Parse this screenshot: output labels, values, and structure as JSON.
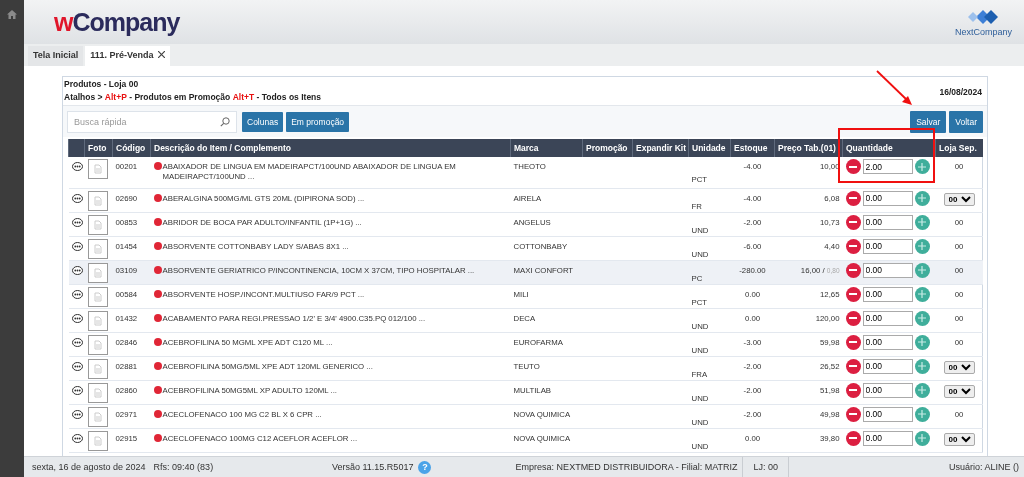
{
  "header": {
    "logo_w": "w",
    "logo_rest": "Company",
    "brand": "NextCompany"
  },
  "tabs": [
    {
      "label": "Tela Inicial",
      "selected": false,
      "closable": false
    },
    {
      "label": "111. Pré-Venda",
      "selected": true,
      "closable": true
    }
  ],
  "panel": {
    "title": "Produtos - Loja 00",
    "shortcuts": "Atalhos > **Alt+P** - Produtos em Promoção **Alt+T** - Todos os Itens",
    "date": "16/08/2024",
    "search": {
      "placeholder": "Busca rápida"
    },
    "left_buttons": [
      "Colunas",
      "Em promoção"
    ],
    "right_buttons": [
      "Salvar",
      "Voltar"
    ]
  },
  "table": {
    "columns": [
      "Foto",
      "Código",
      "Descrição do Item / Complemento",
      "Marca",
      "Promoção",
      "Expandir Kit",
      "Unidade",
      "Estoque",
      "Preço Tab.(01)",
      "Quantidade",
      "Loja Sep."
    ],
    "rows": [
      {
        "code": "00201",
        "description": "ABAIXADOR DE LINGUA EM MADEIRAPCT/100UND ABAIXADOR DE LINGUA EM MADEIRAPCT/100UND ...",
        "brand": "THEOTO",
        "unit": "PCT",
        "stock": "-4.00",
        "price": "10,00",
        "quantity": "2.00",
        "store": {
          "kind": "text",
          "value": "00"
        },
        "highlighted": false
      },
      {
        "code": "02690",
        "description": "ABERALGINA 500MG/ML GTS 20ML (DIPIRONA SOD) ...",
        "brand": "AIRELA",
        "unit": "FR",
        "stock": "-4.00",
        "price": "6,08",
        "quantity": "0.00",
        "store": {
          "kind": "select",
          "value": "00"
        },
        "highlighted": false
      },
      {
        "code": "00853",
        "description": "ABRIDOR DE BOCA PAR ADULTO/INFANTIL (1P+1G) ...",
        "brand": "ANGELUS",
        "unit": "UND",
        "stock": "-2.00",
        "price": "10,73",
        "quantity": "0.00",
        "store": {
          "kind": "text",
          "value": "00"
        },
        "highlighted": false
      },
      {
        "code": "01454",
        "description": "ABSORVENTE COTTONBABY LADY S/ABAS 8X1 ...",
        "brand": "COTTONBABY",
        "unit": "UND",
        "stock": "-6.00",
        "price": "4,40",
        "quantity": "0.00",
        "store": {
          "kind": "text",
          "value": "00"
        },
        "highlighted": false
      },
      {
        "code": "03109",
        "description": "ABSORVENTE GERIATRICO P/INCONTINENCIA, 10CM X 37CM, TIPO HOSPITALAR ...",
        "brand": "MAXI CONFORT",
        "unit": "PC",
        "stock": "-280.00",
        "price": "16,00 /",
        "price_unit": "0,80",
        "quantity": "0.00",
        "store": {
          "kind": "text",
          "value": "00"
        },
        "highlighted": true
      },
      {
        "code": "00584",
        "description": "ABSORVENTE HOSP./INCONT.MULTIUSO FAR/9 PCT ...",
        "brand": "MILI",
        "unit": "PCT",
        "stock": "0.00",
        "price": "12,65",
        "quantity": "0.00",
        "store": {
          "kind": "text",
          "value": "00"
        },
        "highlighted": false
      },
      {
        "code": "01432",
        "description": "ACABAMENTO PARA REGI.PRESSAO 1/2' E 3/4' 4900.C35.PQ 012/100 ...",
        "brand": "DECA",
        "unit": "UND",
        "stock": "0.00",
        "price": "120,00",
        "quantity": "0.00",
        "store": {
          "kind": "text",
          "value": "00"
        },
        "highlighted": false
      },
      {
        "code": "02846",
        "description": "ACEBROFILINA 50 MGML XPE ADT C120 ML ...",
        "brand": "EUROFARMA",
        "unit": "UND",
        "stock": "-3.00",
        "price": "59,98",
        "quantity": "0.00",
        "store": {
          "kind": "text",
          "value": "00"
        },
        "highlighted": false
      },
      {
        "code": "02881",
        "description": "ACEBROFILINA 50MG/5ML XPE ADT 120ML GENERICO ...",
        "brand": "TEUTO",
        "unit": "FRA",
        "stock": "-2.00",
        "price": "26,52",
        "quantity": "0.00",
        "store": {
          "kind": "select",
          "value": "00"
        },
        "highlighted": false
      },
      {
        "code": "02860",
        "description": "ACEBROFILINA 50MG5ML XP ADULTO 120ML ...",
        "brand": "MULTILAB",
        "unit": "UND",
        "stock": "-2.00",
        "price": "51,98",
        "quantity": "0.00",
        "store": {
          "kind": "select",
          "value": "00"
        },
        "highlighted": false
      },
      {
        "code": "02971",
        "description": "ACECLOFENACO 100 MG C2 BL X 6 CPR ...",
        "brand": "NOVA QUIMICA",
        "unit": "UND",
        "stock": "-2.00",
        "price": "49,98",
        "quantity": "0.00",
        "store": {
          "kind": "text",
          "value": "00"
        },
        "highlighted": false
      },
      {
        "code": "02915",
        "description": "ACECLOFENACO 100MG C12 ACEFLOR ACEFLOR ...",
        "brand": "NOVA QUIMICA",
        "unit": "UND",
        "stock": "0.00",
        "price": "39,80",
        "quantity": "0.00",
        "store": {
          "kind": "select",
          "value": "00"
        },
        "highlighted": false
      }
    ]
  },
  "annotations": [
    {
      "kind": "arrow"
    },
    {
      "kind": "box"
    }
  ],
  "status_bar": {
    "date": "sexta, 16 de agosto de 2024",
    "refresh": "Rfs: 09:40 (83)",
    "version": "Versão 11.15.R5017",
    "help": "?",
    "company": "Empresa: NEXTMED DISTRIBUIDORA - Filial: MATRIZ",
    "store": "LJ: 00",
    "user": "Usuário: ALINE ()"
  }
}
